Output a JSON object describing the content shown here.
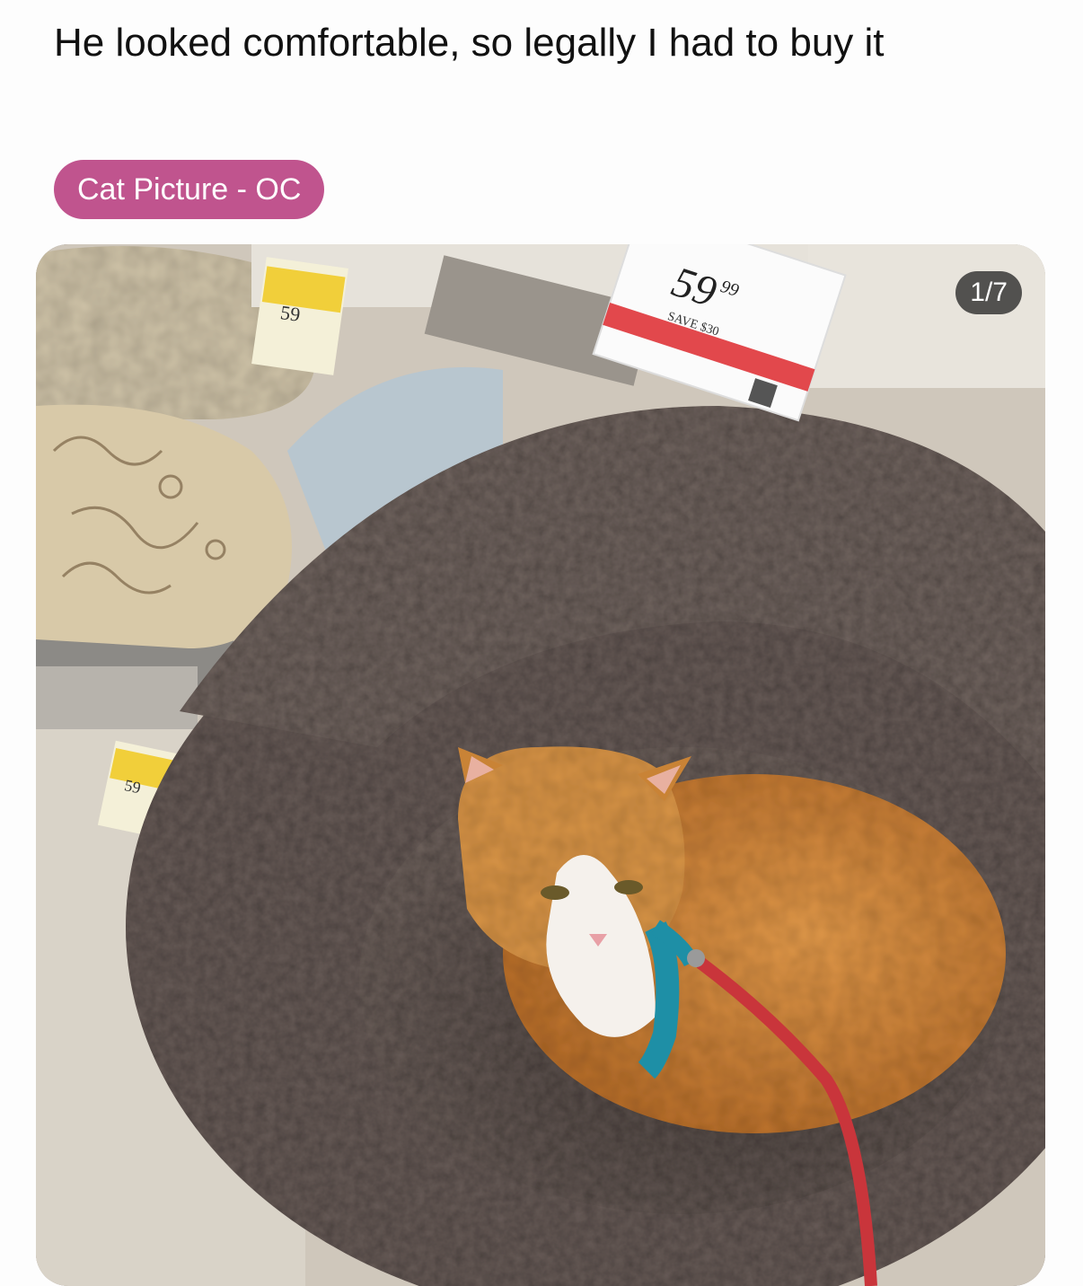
{
  "post": {
    "title": "He looked comfortable, so legally I had to buy it",
    "flair": "Cat Picture - OC"
  },
  "gallery": {
    "counter": "1/7",
    "price_tag": {
      "price_main": "59",
      "price_cents": "99",
      "savings": "SAVE $30"
    },
    "shelf_tags": [
      "59",
      "59"
    ]
  },
  "colors": {
    "flair_bg": "#c0548e",
    "counter_bg": "#282828",
    "bed_fur": "#5e524e",
    "cat_fur": "#d08a3c",
    "harness": "#1e8fa6",
    "leash": "#c9353b",
    "tag_red": "#e2484c"
  }
}
